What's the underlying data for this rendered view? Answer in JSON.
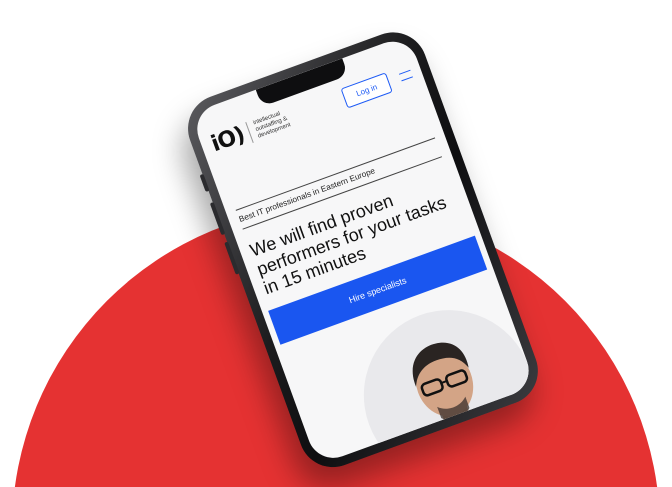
{
  "header": {
    "logo_mark": "iO)",
    "logo_text": "intellectual outstaffing & development",
    "login_label": "Log in"
  },
  "hero": {
    "subtitle": "Best IT professionals in Eastern Europe",
    "headline": "We will find proven performers for your tasks in 15 minutes",
    "cta_label": "Hire specialists"
  },
  "colors": {
    "accent_red": "#E53232",
    "brand_blue": "#1A56F0"
  },
  "icons": [
    "menu-icon"
  ]
}
